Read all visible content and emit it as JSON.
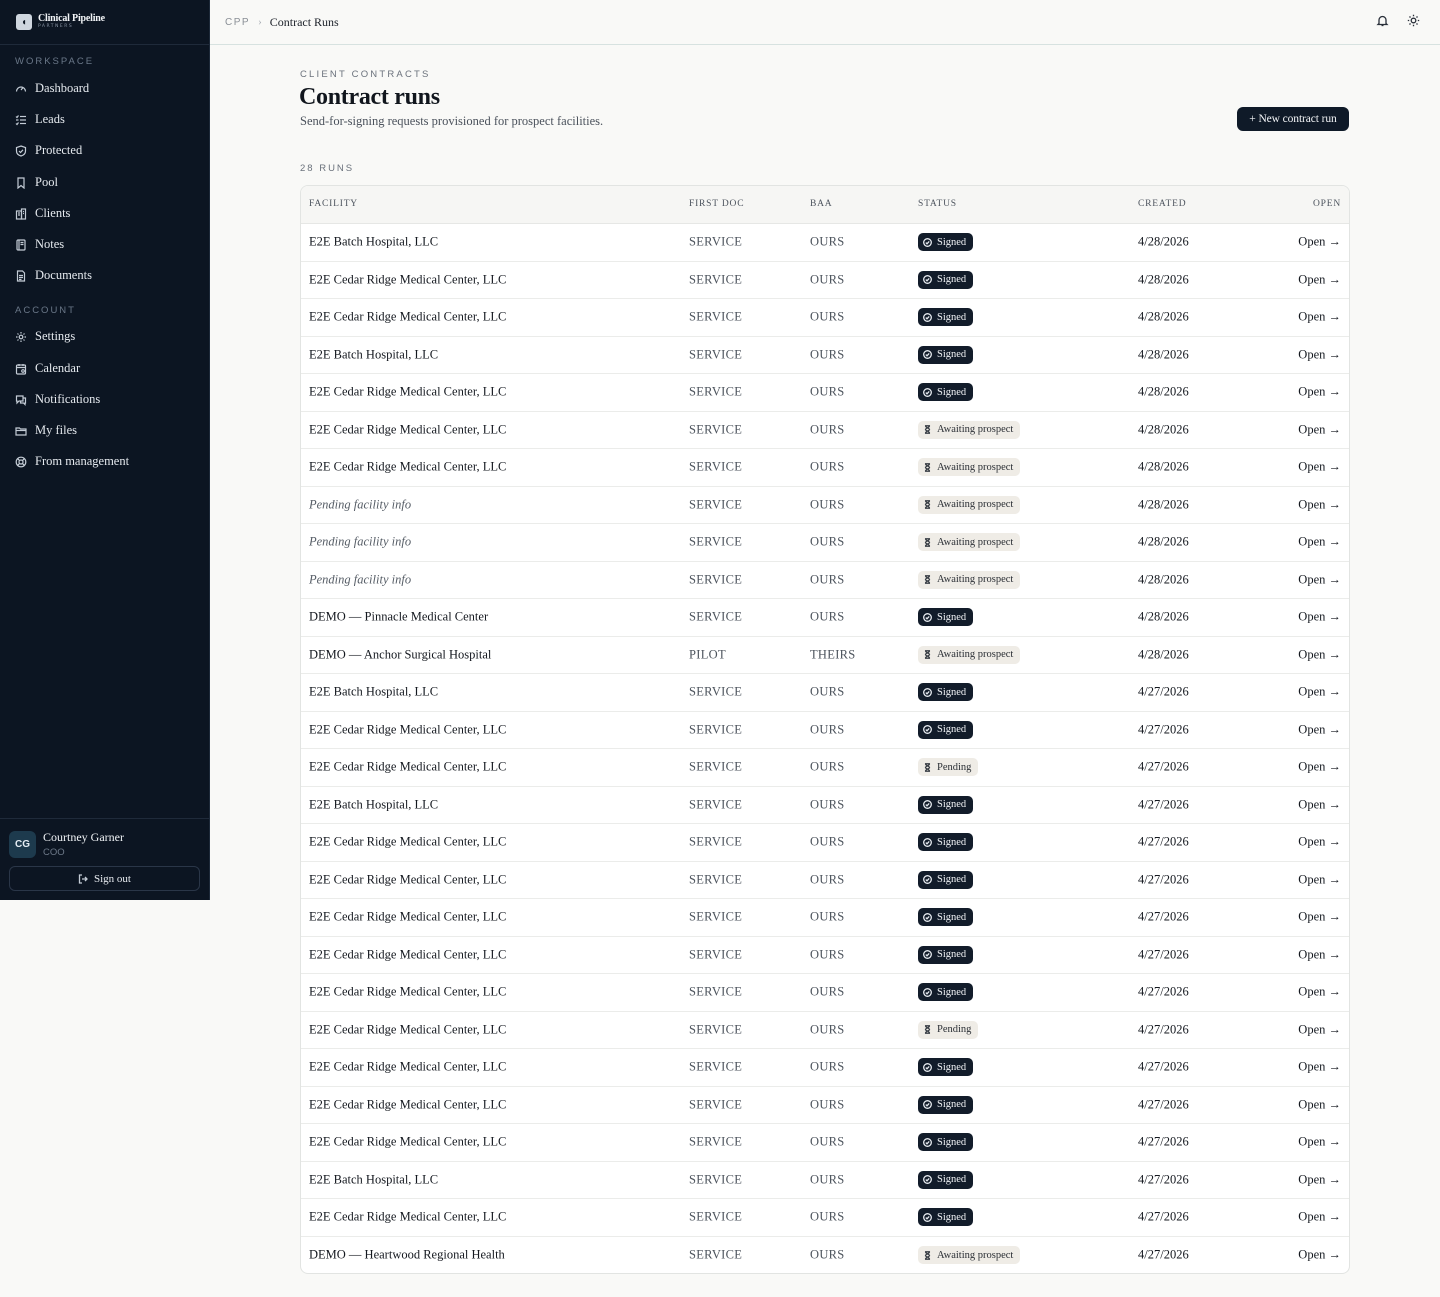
{
  "brand": {
    "name": "Clinical Pipeline",
    "sub": "PARTNERS"
  },
  "sidebar": {
    "workspace_label": "WORKSPACE",
    "workspace_items": [
      {
        "label": "Dashboard",
        "icon": "gauge-icon"
      },
      {
        "label": "Leads",
        "icon": "list-check-icon"
      },
      {
        "label": "Protected",
        "icon": "shield-check-icon"
      },
      {
        "label": "Pool",
        "icon": "bookmark-icon"
      },
      {
        "label": "Clients",
        "icon": "building-icon"
      },
      {
        "label": "Notes",
        "icon": "notebook-icon"
      },
      {
        "label": "Documents",
        "icon": "document-icon"
      }
    ],
    "account_label": "ACCOUNT",
    "account_items": [
      {
        "label": "Settings",
        "icon": "gear-icon"
      },
      {
        "label": "Calendar",
        "icon": "calendar-icon"
      },
      {
        "label": "Notifications",
        "icon": "message-icon"
      },
      {
        "label": "My files",
        "icon": "folder-icon"
      },
      {
        "label": "From management",
        "icon": "lifebuoy-icon"
      }
    ]
  },
  "user": {
    "initials": "CG",
    "name": "Courtney Garner",
    "role": "COO",
    "signout_label": "Sign out"
  },
  "breadcrumb": {
    "root": "CPP",
    "current": "Contract Runs"
  },
  "page": {
    "eyebrow": "CLIENT CONTRACTS",
    "title": "Contract runs",
    "subtitle": "Send-for-signing requests provisioned for prospect facilities.",
    "new_button": "+ New contract run",
    "runs_count": "28 RUNS"
  },
  "table": {
    "headers": {
      "facility": "FACILITY",
      "first_doc": "FIRST DOC",
      "baa": "BAA",
      "status": "STATUS",
      "created": "CREATED",
      "open": "OPEN"
    },
    "open_label": "Open →",
    "status_colors": {
      "signed": "#121c2a",
      "awaiting": "#efece6"
    },
    "rows": [
      {
        "facility": "E2E Batch Hospital, LLC",
        "first_doc": "SERVICE",
        "baa": "OURS",
        "status": "Signed",
        "created": "4/28/2026"
      },
      {
        "facility": "E2E Cedar Ridge Medical Center, LLC",
        "first_doc": "SERVICE",
        "baa": "OURS",
        "status": "Signed",
        "created": "4/28/2026"
      },
      {
        "facility": "E2E Cedar Ridge Medical Center, LLC",
        "first_doc": "SERVICE",
        "baa": "OURS",
        "status": "Signed",
        "created": "4/28/2026"
      },
      {
        "facility": "E2E Batch Hospital, LLC",
        "first_doc": "SERVICE",
        "baa": "OURS",
        "status": "Signed",
        "created": "4/28/2026"
      },
      {
        "facility": "E2E Cedar Ridge Medical Center, LLC",
        "first_doc": "SERVICE",
        "baa": "OURS",
        "status": "Signed",
        "created": "4/28/2026"
      },
      {
        "facility": "E2E Cedar Ridge Medical Center, LLC",
        "first_doc": "SERVICE",
        "baa": "OURS",
        "status": "Awaiting prospect",
        "created": "4/28/2026"
      },
      {
        "facility": "E2E Cedar Ridge Medical Center, LLC",
        "first_doc": "SERVICE",
        "baa": "OURS",
        "status": "Awaiting prospect",
        "created": "4/28/2026"
      },
      {
        "facility": "Pending facility info",
        "pending": true,
        "first_doc": "SERVICE",
        "baa": "OURS",
        "status": "Awaiting prospect",
        "created": "4/28/2026"
      },
      {
        "facility": "Pending facility info",
        "pending": true,
        "first_doc": "SERVICE",
        "baa": "OURS",
        "status": "Awaiting prospect",
        "created": "4/28/2026"
      },
      {
        "facility": "Pending facility info",
        "pending": true,
        "first_doc": "SERVICE",
        "baa": "OURS",
        "status": "Awaiting prospect",
        "created": "4/28/2026"
      },
      {
        "facility": "DEMO — Pinnacle Medical Center",
        "first_doc": "SERVICE",
        "baa": "OURS",
        "status": "Signed",
        "created": "4/28/2026"
      },
      {
        "facility": "DEMO — Anchor Surgical Hospital",
        "first_doc": "PILOT",
        "baa": "THEIRS",
        "status": "Awaiting prospect",
        "created": "4/28/2026"
      },
      {
        "facility": "E2E Batch Hospital, LLC",
        "first_doc": "SERVICE",
        "baa": "OURS",
        "status": "Signed",
        "created": "4/27/2026"
      },
      {
        "facility": "E2E Cedar Ridge Medical Center, LLC",
        "first_doc": "SERVICE",
        "baa": "OURS",
        "status": "Signed",
        "created": "4/27/2026"
      },
      {
        "facility": "E2E Cedar Ridge Medical Center, LLC",
        "first_doc": "SERVICE",
        "baa": "OURS",
        "status": "Pending",
        "created": "4/27/2026"
      },
      {
        "facility": "E2E Batch Hospital, LLC",
        "first_doc": "SERVICE",
        "baa": "OURS",
        "status": "Signed",
        "created": "4/27/2026"
      },
      {
        "facility": "E2E Cedar Ridge Medical Center, LLC",
        "first_doc": "SERVICE",
        "baa": "OURS",
        "status": "Signed",
        "created": "4/27/2026"
      },
      {
        "facility": "E2E Cedar Ridge Medical Center, LLC",
        "first_doc": "SERVICE",
        "baa": "OURS",
        "status": "Signed",
        "created": "4/27/2026"
      },
      {
        "facility": "E2E Cedar Ridge Medical Center, LLC",
        "first_doc": "SERVICE",
        "baa": "OURS",
        "status": "Signed",
        "created": "4/27/2026"
      },
      {
        "facility": "E2E Cedar Ridge Medical Center, LLC",
        "first_doc": "SERVICE",
        "baa": "OURS",
        "status": "Signed",
        "created": "4/27/2026"
      },
      {
        "facility": "E2E Cedar Ridge Medical Center, LLC",
        "first_doc": "SERVICE",
        "baa": "OURS",
        "status": "Signed",
        "created": "4/27/2026"
      },
      {
        "facility": "E2E Cedar Ridge Medical Center, LLC",
        "first_doc": "SERVICE",
        "baa": "OURS",
        "status": "Pending",
        "created": "4/27/2026"
      },
      {
        "facility": "E2E Cedar Ridge Medical Center, LLC",
        "first_doc": "SERVICE",
        "baa": "OURS",
        "status": "Signed",
        "created": "4/27/2026"
      },
      {
        "facility": "E2E Cedar Ridge Medical Center, LLC",
        "first_doc": "SERVICE",
        "baa": "OURS",
        "status": "Signed",
        "created": "4/27/2026"
      },
      {
        "facility": "E2E Cedar Ridge Medical Center, LLC",
        "first_doc": "SERVICE",
        "baa": "OURS",
        "status": "Signed",
        "created": "4/27/2026"
      },
      {
        "facility": "E2E Batch Hospital, LLC",
        "first_doc": "SERVICE",
        "baa": "OURS",
        "status": "Signed",
        "created": "4/27/2026"
      },
      {
        "facility": "E2E Cedar Ridge Medical Center, LLC",
        "first_doc": "SERVICE",
        "baa": "OURS",
        "status": "Signed",
        "created": "4/27/2026"
      },
      {
        "facility": "DEMO — Heartwood Regional Health",
        "first_doc": "SERVICE",
        "baa": "OURS",
        "status": "Awaiting prospect",
        "created": "4/27/2026"
      }
    ]
  }
}
